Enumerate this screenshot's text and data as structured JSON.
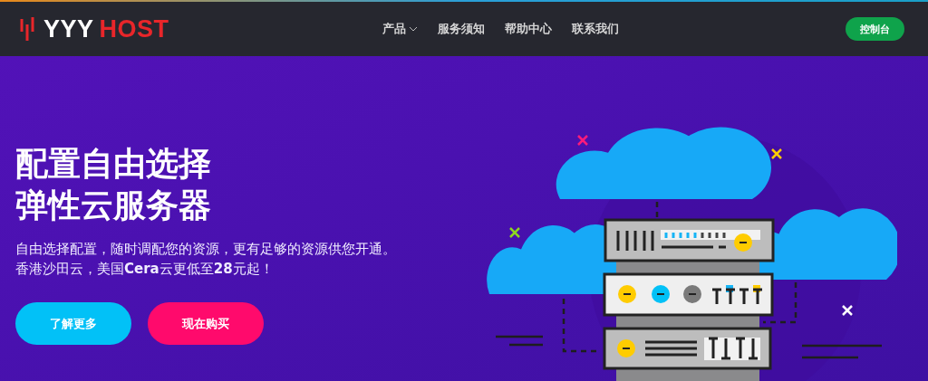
{
  "header": {
    "logo": {
      "wordmark": "YYY",
      "accent": "HOST"
    },
    "nav": [
      {
        "label": "产品",
        "has_dropdown": true
      },
      {
        "label": "服务须知",
        "has_dropdown": false
      },
      {
        "label": "帮助中心",
        "has_dropdown": false
      },
      {
        "label": "联系我们",
        "has_dropdown": false
      }
    ],
    "console_button": "控制台"
  },
  "hero": {
    "title_lines": [
      "配置自由选择",
      "弹性云服务器"
    ],
    "subtitle_lines": [
      "自由选择配置，随时调配您的资源，更有足够的资源供您开通。",
      "香港沙田云，美国**Cera**云更低至**28**元起！"
    ],
    "buttons": [
      {
        "label": "了解更多",
        "kind": "secondary"
      },
      {
        "label": "现在购买",
        "kind": "primary"
      }
    ]
  }
}
